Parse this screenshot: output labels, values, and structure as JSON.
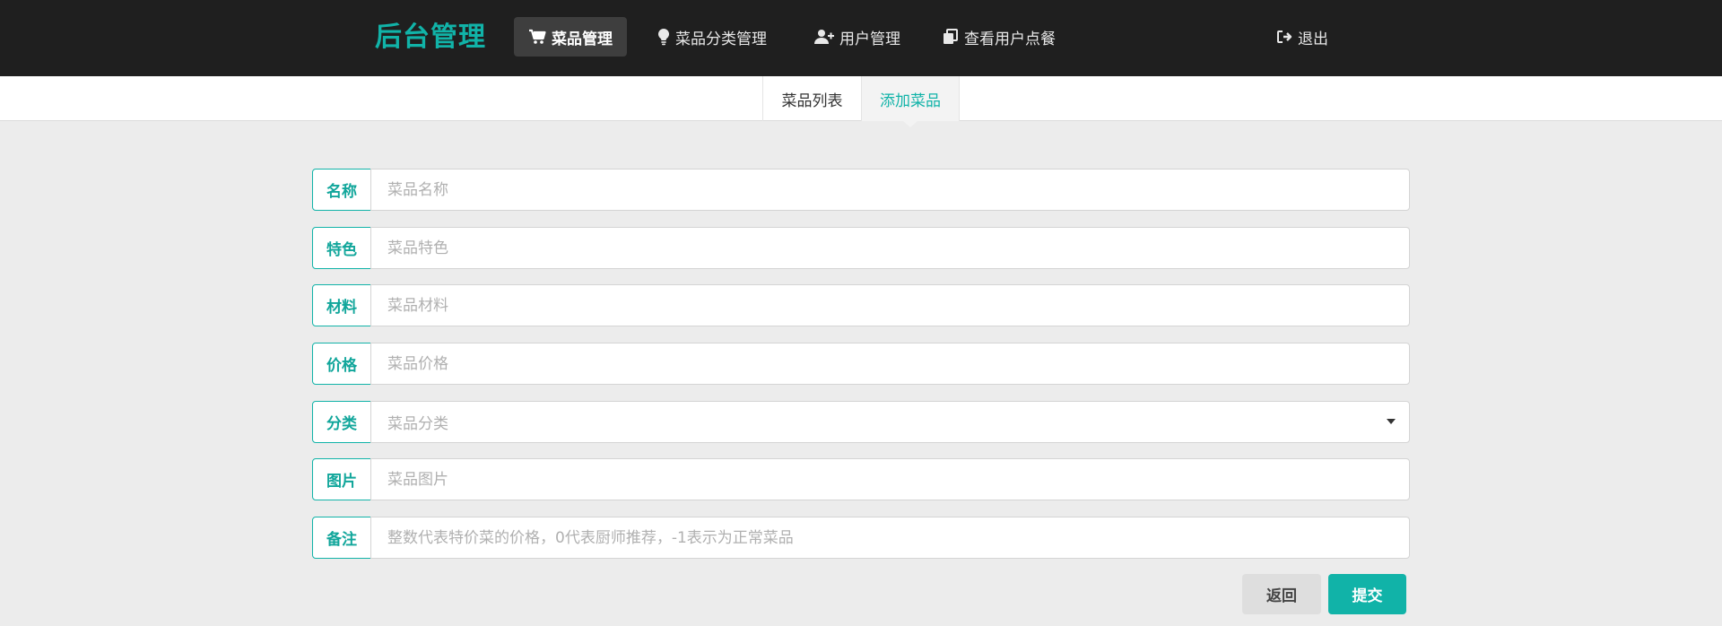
{
  "navbar": {
    "brand": "后台管理",
    "items": [
      {
        "label": "菜品管理",
        "icon": "cart-icon",
        "active": true
      },
      {
        "label": "菜品分类管理",
        "icon": "lightbulb-icon",
        "active": false
      },
      {
        "label": "用户管理",
        "icon": "user-plus-icon",
        "active": false
      },
      {
        "label": "查看用户点餐",
        "icon": "copy-icon",
        "active": false
      }
    ],
    "logout": {
      "label": "退出",
      "icon": "sign-out-icon"
    }
  },
  "subtabs": [
    {
      "label": "菜品列表",
      "active": false
    },
    {
      "label": "添加菜品",
      "active": true
    }
  ],
  "form": {
    "fields": [
      {
        "label": "名称",
        "placeholder": "菜品名称",
        "value": ""
      },
      {
        "label": "特色",
        "placeholder": "菜品特色",
        "value": ""
      },
      {
        "label": "材料",
        "placeholder": "菜品材料",
        "value": ""
      },
      {
        "label": "价格",
        "placeholder": "菜品价格",
        "value": ""
      },
      {
        "label": "分类",
        "placeholder": "菜品分类",
        "value": "",
        "type": "select"
      },
      {
        "label": "图片",
        "placeholder": "菜品图片",
        "value": ""
      },
      {
        "label": "备注",
        "placeholder": "整数代表特价菜的价格，0代表厨师推荐，-1表示为正常菜品",
        "value": ""
      }
    ],
    "back_label": "返回",
    "submit_label": "提交"
  },
  "colors": {
    "accent": "#11b3a8",
    "navbar_bg": "#1f1f1f",
    "page_bg": "#ececec"
  }
}
